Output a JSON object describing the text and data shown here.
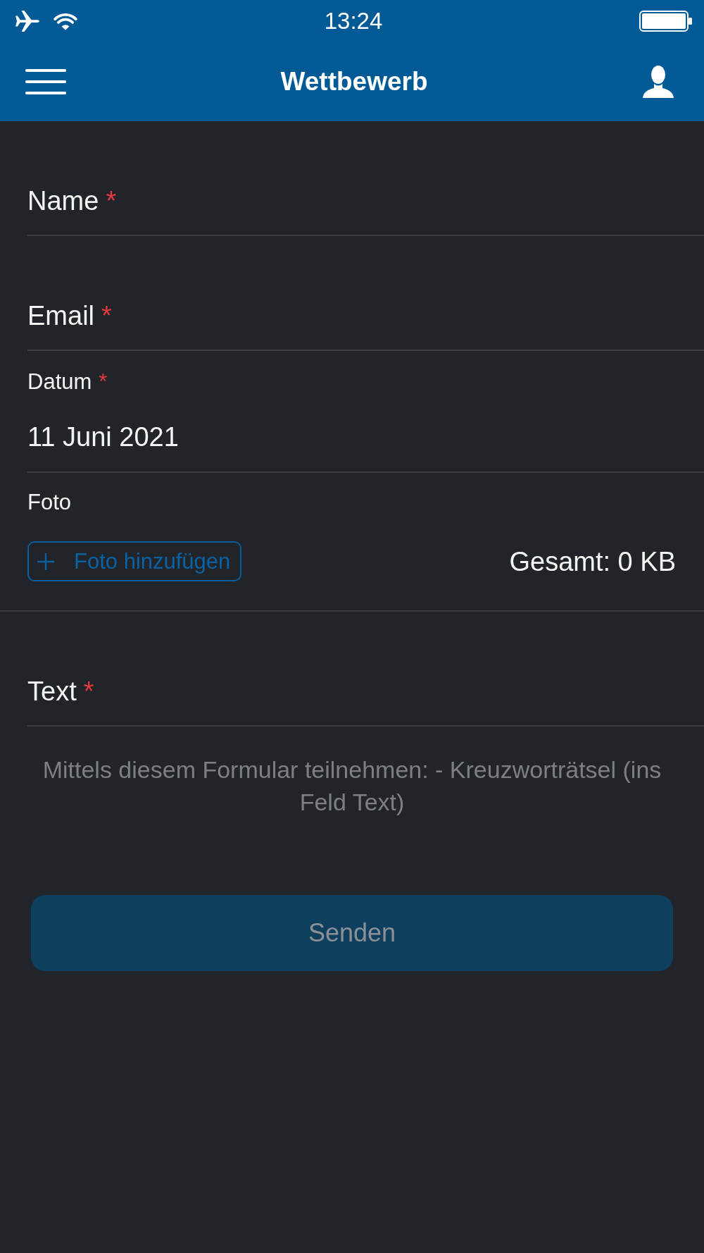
{
  "status_bar": {
    "time": "13:24"
  },
  "header": {
    "title": "Wettbewerb"
  },
  "form": {
    "fields": [
      {
        "kind": "text",
        "label": "Name",
        "required_mark": "*"
      },
      {
        "kind": "text",
        "label": "Email",
        "required_mark": "*"
      },
      {
        "kind": "date",
        "label": "Datum",
        "required_mark": "*",
        "value": "11 Juni 2021"
      },
      {
        "kind": "photo",
        "label": "Foto",
        "button": "Foto hinzufügen",
        "total": "Gesamt: 0 KB"
      },
      {
        "kind": "text",
        "label": "Text",
        "required_mark": "*"
      }
    ],
    "hint": "Mittels diesem Formular teilnehmen: - Kreuzworträtsel (ins Feld Text)",
    "submit": {
      "label": "Senden",
      "disabled": true
    }
  }
}
